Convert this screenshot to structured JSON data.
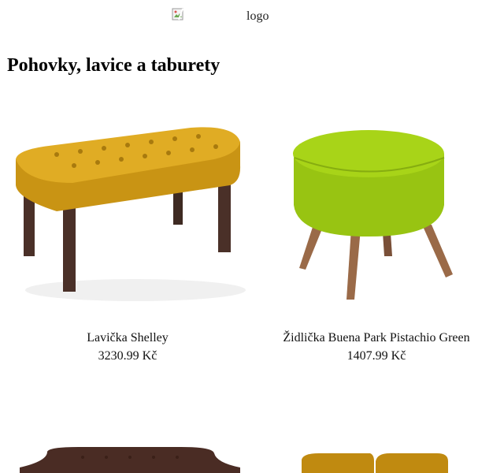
{
  "header": {
    "logo_alt": "logo"
  },
  "page": {
    "title": "Pohovky, lavice a taburety"
  },
  "products": [
    {
      "name": "Lavička Shelley",
      "price": "3230.99 Kč",
      "color": "#d8a420",
      "legs": "#4a3028"
    },
    {
      "name": "Židlička Buena Park Pistachio Green",
      "price": "1407.99 Kč",
      "color": "#a6d214",
      "legs": "#8a5a3c"
    },
    {
      "name": "",
      "price": "",
      "color": "#4a2c24"
    },
    {
      "name": "",
      "price": "",
      "color": "#c08a10"
    }
  ],
  "icons": {
    "broken_image": "broken-image-icon"
  }
}
